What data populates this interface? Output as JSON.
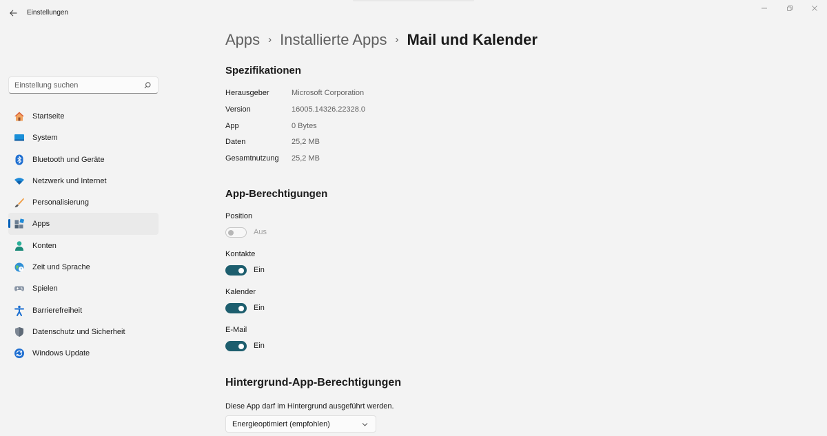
{
  "window": {
    "title": "Einstellungen",
    "back_icon": "arrow-left-icon",
    "minimize_icon": "minimize-icon",
    "maximize_icon": "restore-icon",
    "close_icon": "close-icon"
  },
  "search": {
    "placeholder": "Einstellung suchen",
    "icon": "search-icon"
  },
  "sidebar": {
    "accent_color": "#005fb8",
    "items": [
      {
        "label": "Startseite",
        "icon": "home-icon",
        "selected": false
      },
      {
        "label": "System",
        "icon": "monitor-icon",
        "selected": false
      },
      {
        "label": "Bluetooth und Geräte",
        "icon": "bluetooth-icon",
        "selected": false
      },
      {
        "label": "Netzwerk und Internet",
        "icon": "wifi-icon",
        "selected": false
      },
      {
        "label": "Personalisierung",
        "icon": "brush-icon",
        "selected": false
      },
      {
        "label": "Apps",
        "icon": "apps-icon",
        "selected": true
      },
      {
        "label": "Konten",
        "icon": "person-icon",
        "selected": false
      },
      {
        "label": "Zeit und Sprache",
        "icon": "globe-clock-icon",
        "selected": false
      },
      {
        "label": "Spielen",
        "icon": "gamepad-icon",
        "selected": false
      },
      {
        "label": "Barrierefreiheit",
        "icon": "accessibility-icon",
        "selected": false
      },
      {
        "label": "Datenschutz und Sicherheit",
        "icon": "shield-icon",
        "selected": false
      },
      {
        "label": "Windows Update",
        "icon": "update-icon",
        "selected": false
      }
    ]
  },
  "breadcrumb": {
    "items": [
      "Apps",
      "Installierte Apps"
    ],
    "separator": "›",
    "current": "Mail und Kalender"
  },
  "specs": {
    "title": "Spezifikationen",
    "rows": [
      {
        "key": "Herausgeber",
        "value": "Microsoft Corporation"
      },
      {
        "key": "Version",
        "value": "16005.14326.22328.0"
      },
      {
        "key": "App",
        "value": "0 Bytes"
      },
      {
        "key": "Daten",
        "value": "25,2 MB"
      },
      {
        "key": "Gesamtnutzung",
        "value": "25,2 MB"
      }
    ]
  },
  "permissions": {
    "title": "App-Berechtigungen",
    "toggle_on_color": "#1d5e6e",
    "items": [
      {
        "label": "Position",
        "state": "Aus",
        "on": false,
        "disabled": true
      },
      {
        "label": "Kontakte",
        "state": "Ein",
        "on": true,
        "disabled": false
      },
      {
        "label": "Kalender",
        "state": "Ein",
        "on": true,
        "disabled": false
      },
      {
        "label": "E-Mail",
        "state": "Ein",
        "on": true,
        "disabled": false
      }
    ]
  },
  "background": {
    "title": "Hintergrund-App-Berechtigungen",
    "description": "Diese App darf im Hintergrund ausgeführt werden.",
    "selected": "Energieoptimiert (empfohlen)",
    "chevron_icon": "chevron-down-icon"
  }
}
